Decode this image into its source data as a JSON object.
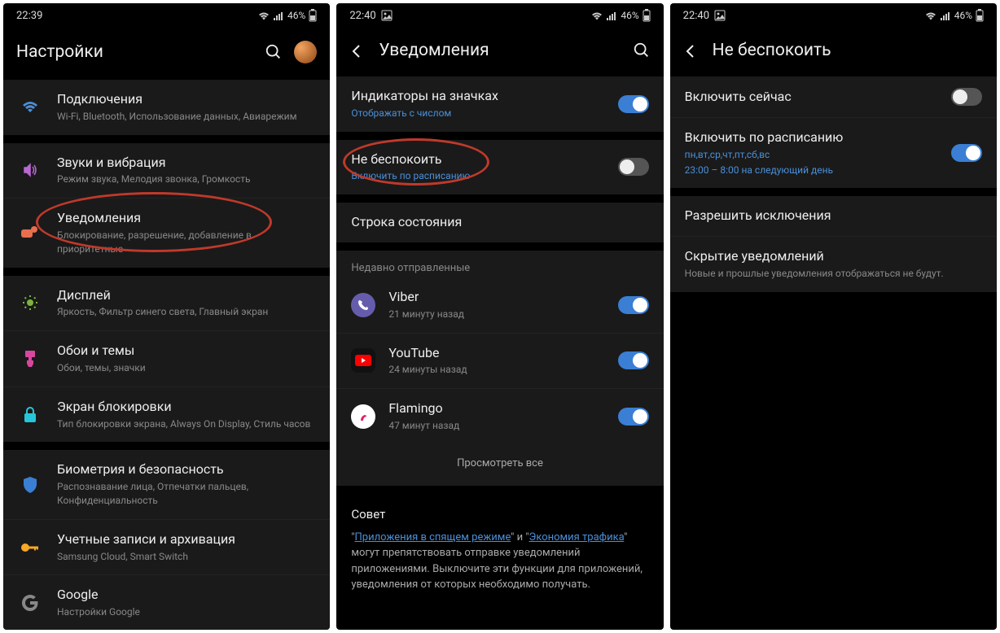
{
  "screen1": {
    "status": {
      "time": "22:39",
      "battery": "46%"
    },
    "title": "Настройки",
    "items": [
      {
        "title": "Подключения",
        "sub": "Wi-Fi, Bluetooth, Использование данных, Авиарежим"
      },
      {
        "title": "Звуки и вибрация",
        "sub": "Режим звука, Мелодия звонка, Громкость"
      },
      {
        "title": "Уведомления",
        "sub": "Блокирование, разрешение, добавление в приоритетные"
      },
      {
        "title": "Дисплей",
        "sub": "Яркость, Фильтр синего света, Главный экран"
      },
      {
        "title": "Обои и темы",
        "sub": "Обои, темы, значки"
      },
      {
        "title": "Экран блокировки",
        "sub": "Тип блокировки экрана, Always On Display, Стиль часов"
      },
      {
        "title": "Биометрия и безопасность",
        "sub": "Распознавание лица, Отпечатки пальцев, Конфиденциальность"
      },
      {
        "title": "Учетные записи и архивация",
        "sub": "Samsung Cloud, Smart Switch"
      },
      {
        "title": "Google",
        "sub": "Настройки Google"
      }
    ]
  },
  "screen2": {
    "status": {
      "time": "22:40",
      "battery": "46%"
    },
    "title": "Уведомления",
    "badges": {
      "title": "Индикаторы на значках",
      "sub": "Отображать с числом"
    },
    "dnd": {
      "title": "Не беспокоить",
      "sub": "Включить по расписанию"
    },
    "statusbar": {
      "title": "Строка состояния"
    },
    "recent_label": "Недавно отправленные",
    "apps": [
      {
        "name": "Viber",
        "sub": "21 минуту назад"
      },
      {
        "name": "YouTube",
        "sub": "24 минуты назад"
      },
      {
        "name": "Flamingo",
        "sub": "47 минут назад"
      }
    ],
    "view_all": "Просмотреть все",
    "tip_title": "Совет",
    "tip_pre": "\"",
    "tip_link1": "Приложения в спящем режиме",
    "tip_mid": "\" и \"",
    "tip_link2": "Экономия трафика",
    "tip_post": "\" могут препятствовать отправке уведомлений приложениями. Выключите эти функции для приложений, уведомления от которых необходимо получать."
  },
  "screen3": {
    "status": {
      "time": "22:40",
      "battery": "46%"
    },
    "title": "Не беспокоить",
    "enable_now": "Включить сейчас",
    "schedule": {
      "title": "Включить по расписанию",
      "sub1": "пн,вт,ср,чт,пт,сб,вс",
      "sub2": "23:00 – 8:00 на следующий день"
    },
    "exceptions": "Разрешить исключения",
    "hide": {
      "title": "Скрытие уведомлений",
      "sub": "Новые и прошлые уведомления отображаться не будут."
    }
  }
}
